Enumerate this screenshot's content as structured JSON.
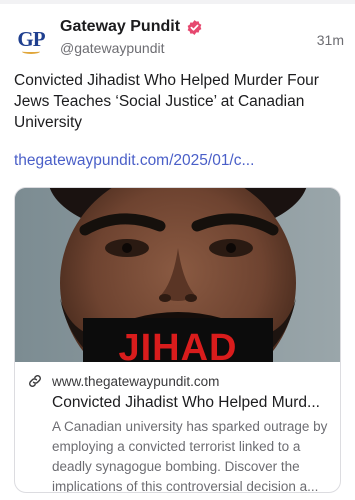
{
  "author": {
    "display_name": "Gateway Pundit",
    "handle": "@gatewaypundit",
    "avatar_text": "GP",
    "verified_icon": "verified-badge-icon",
    "time": "31m"
  },
  "post": {
    "text": "Convicted Jihadist Who Helped Murder Four Jews Teaches ‘Social Justice’ at Canadian University",
    "link": "thegatewaypundit.com/2025/01/c..."
  },
  "card": {
    "image_banner": "JIHAD",
    "link_icon": "link-icon",
    "domain": "www.thegatewaypundit.com",
    "title": "Convicted Jihadist Who Helped Murd...",
    "description": "A Canadian university has sparked outrage by employing a convicted terrorist linked to a deadly synagogue bombing. Discover the implications of this controversial decision a..."
  },
  "colors": {
    "link": "#4a5fc8",
    "verified": "#e6486f",
    "banner_text": "#d91c1c",
    "avatar": "#1f3f8f"
  }
}
